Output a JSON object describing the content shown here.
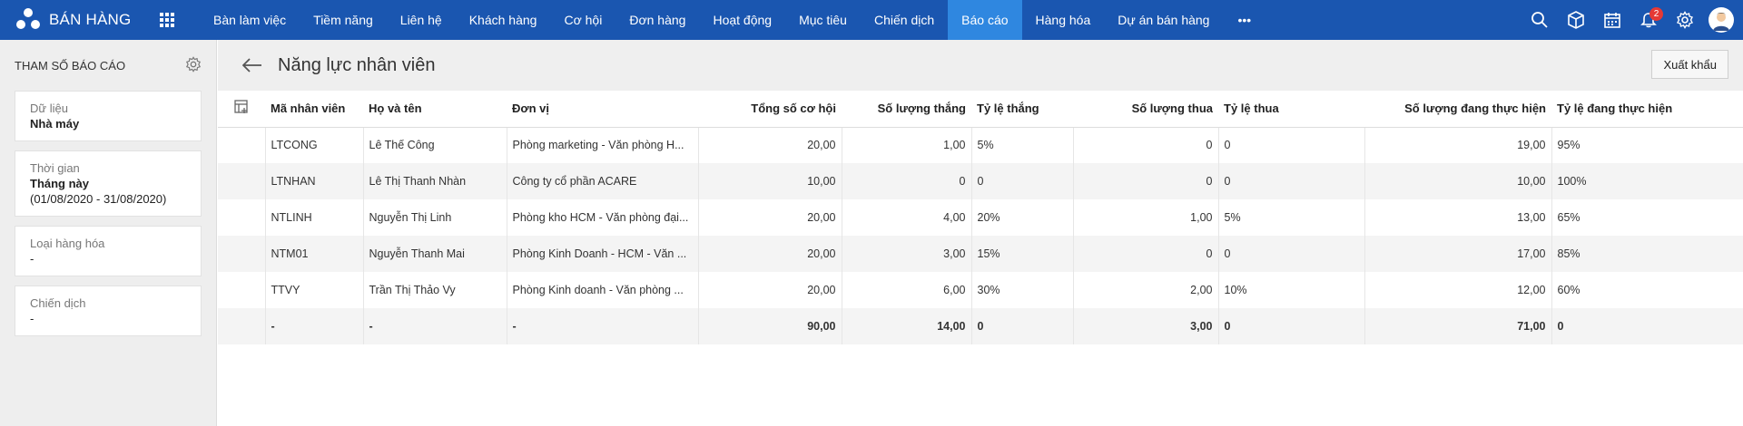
{
  "app": {
    "title": "BÁN HÀNG",
    "notification_count": "2"
  },
  "nav": {
    "items": [
      {
        "label": "Bàn làm việc"
      },
      {
        "label": "Tiềm năng"
      },
      {
        "label": "Liên hệ"
      },
      {
        "label": "Khách hàng"
      },
      {
        "label": "Cơ hội"
      },
      {
        "label": "Đơn hàng"
      },
      {
        "label": "Hoạt động"
      },
      {
        "label": "Mục tiêu"
      },
      {
        "label": "Chiến dịch"
      },
      {
        "label": "Báo cáo",
        "active": true
      },
      {
        "label": "Hàng hóa"
      },
      {
        "label": "Dự án bán hàng"
      }
    ],
    "more_label": "•••"
  },
  "sidebar": {
    "title": "THAM SỐ BÁO CÁO",
    "params": [
      {
        "label": "Dữ liệu",
        "value": "Nhà máy"
      },
      {
        "label": "Thời gian",
        "value": "Tháng này",
        "sub": "(01/08/2020 - 31/08/2020)"
      },
      {
        "label": "Loại hàng hóa",
        "value": "-"
      },
      {
        "label": "Chiến dịch",
        "value": "-"
      }
    ]
  },
  "main": {
    "title": "Năng lực nhân viên",
    "export_label": "Xuất khẩu"
  },
  "table": {
    "headers": [
      "Mã nhân viên",
      "Họ và tên",
      "Đơn vị",
      "Tổng số cơ hội",
      "Số lượng thắng",
      "Tỷ lệ thắng",
      "Số lượng thua",
      "Tỷ lệ thua",
      "Số lượng đang thực hiện",
      "Tỷ lệ đang thực hiện"
    ],
    "rows": [
      [
        "LTCONG",
        "Lê Thế Công",
        "Phòng marketing - Văn phòng H...",
        "20,00",
        "1,00",
        "5%",
        "0",
        "0",
        "19,00",
        "95%"
      ],
      [
        "LTNHAN",
        "Lê Thị Thanh Nhàn",
        "Công ty cổ phần ACARE",
        "10,00",
        "0",
        "0",
        "0",
        "0",
        "10,00",
        "100%"
      ],
      [
        "NTLINH",
        "Nguyễn Thị Linh",
        "Phòng kho HCM - Văn phòng đại...",
        "20,00",
        "4,00",
        "20%",
        "1,00",
        "5%",
        "13,00",
        "65%"
      ],
      [
        "NTM01",
        "Nguyễn Thanh Mai",
        "Phòng Kinh Doanh - HCM - Văn ...",
        "20,00",
        "3,00",
        "15%",
        "0",
        "0",
        "17,00",
        "85%"
      ],
      [
        "TTVY",
        "Trần Thị Thảo Vy",
        "Phòng Kinh doanh - Văn phòng ...",
        "20,00",
        "6,00",
        "30%",
        "2,00",
        "10%",
        "12,00",
        "60%"
      ]
    ],
    "total": [
      "-",
      "-",
      "-",
      "90,00",
      "14,00",
      "0",
      "3,00",
      "0",
      "71,00",
      "0"
    ]
  },
  "colors": {
    "topbar": "#1a56b0",
    "active_tab": "#2f87e0",
    "badge": "#e53935"
  }
}
